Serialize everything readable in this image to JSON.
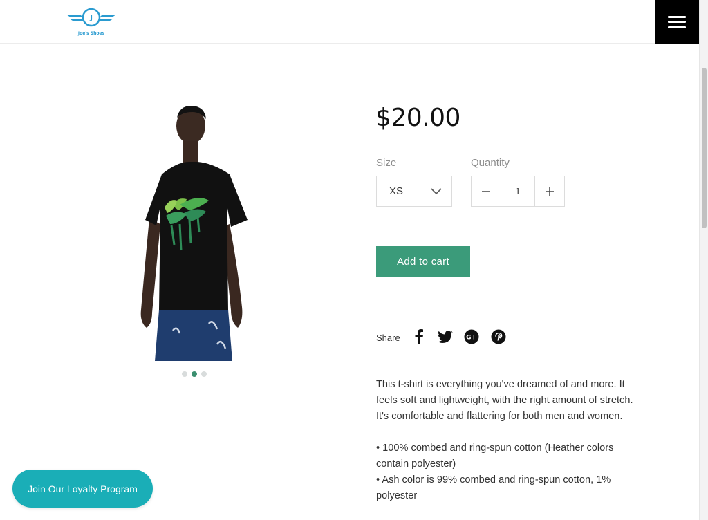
{
  "header": {
    "logo_text": "Joe's Shoes",
    "logo_letter": "J",
    "menu_icon": "hamburger-icon"
  },
  "product": {
    "price": "$20.00",
    "image_alt": "Man wearing black t-shirt with tropical leaf print",
    "gallery": {
      "total": 3,
      "active_index": 1
    },
    "size": {
      "label": "Size",
      "value": "XS"
    },
    "quantity": {
      "label": "Quantity",
      "value": "1",
      "minus": "−",
      "plus": "+"
    },
    "add_to_cart": "Add to cart"
  },
  "share": {
    "label": "Share",
    "networks": [
      "facebook-icon",
      "twitter-icon",
      "google-plus-icon",
      "pinterest-icon"
    ]
  },
  "description": {
    "paragraph": "This t-shirt is everything you've dreamed of and more. It feels soft and lightweight, with the right amount of stretch. It's comfortable and flattering for both men and women.",
    "bullets": [
      "• 100% combed and ring-spun cotton (Heather colors contain polyester)",
      "• Ash color is 99% combed and ring-spun cotton, 1% polyester"
    ]
  },
  "loyalty": {
    "label": "Join Our Loyalty Program"
  },
  "colors": {
    "accent_green": "#3b9b7a",
    "loyalty_teal": "#1aaeb7",
    "logo_blue": "#2a9bd0"
  }
}
